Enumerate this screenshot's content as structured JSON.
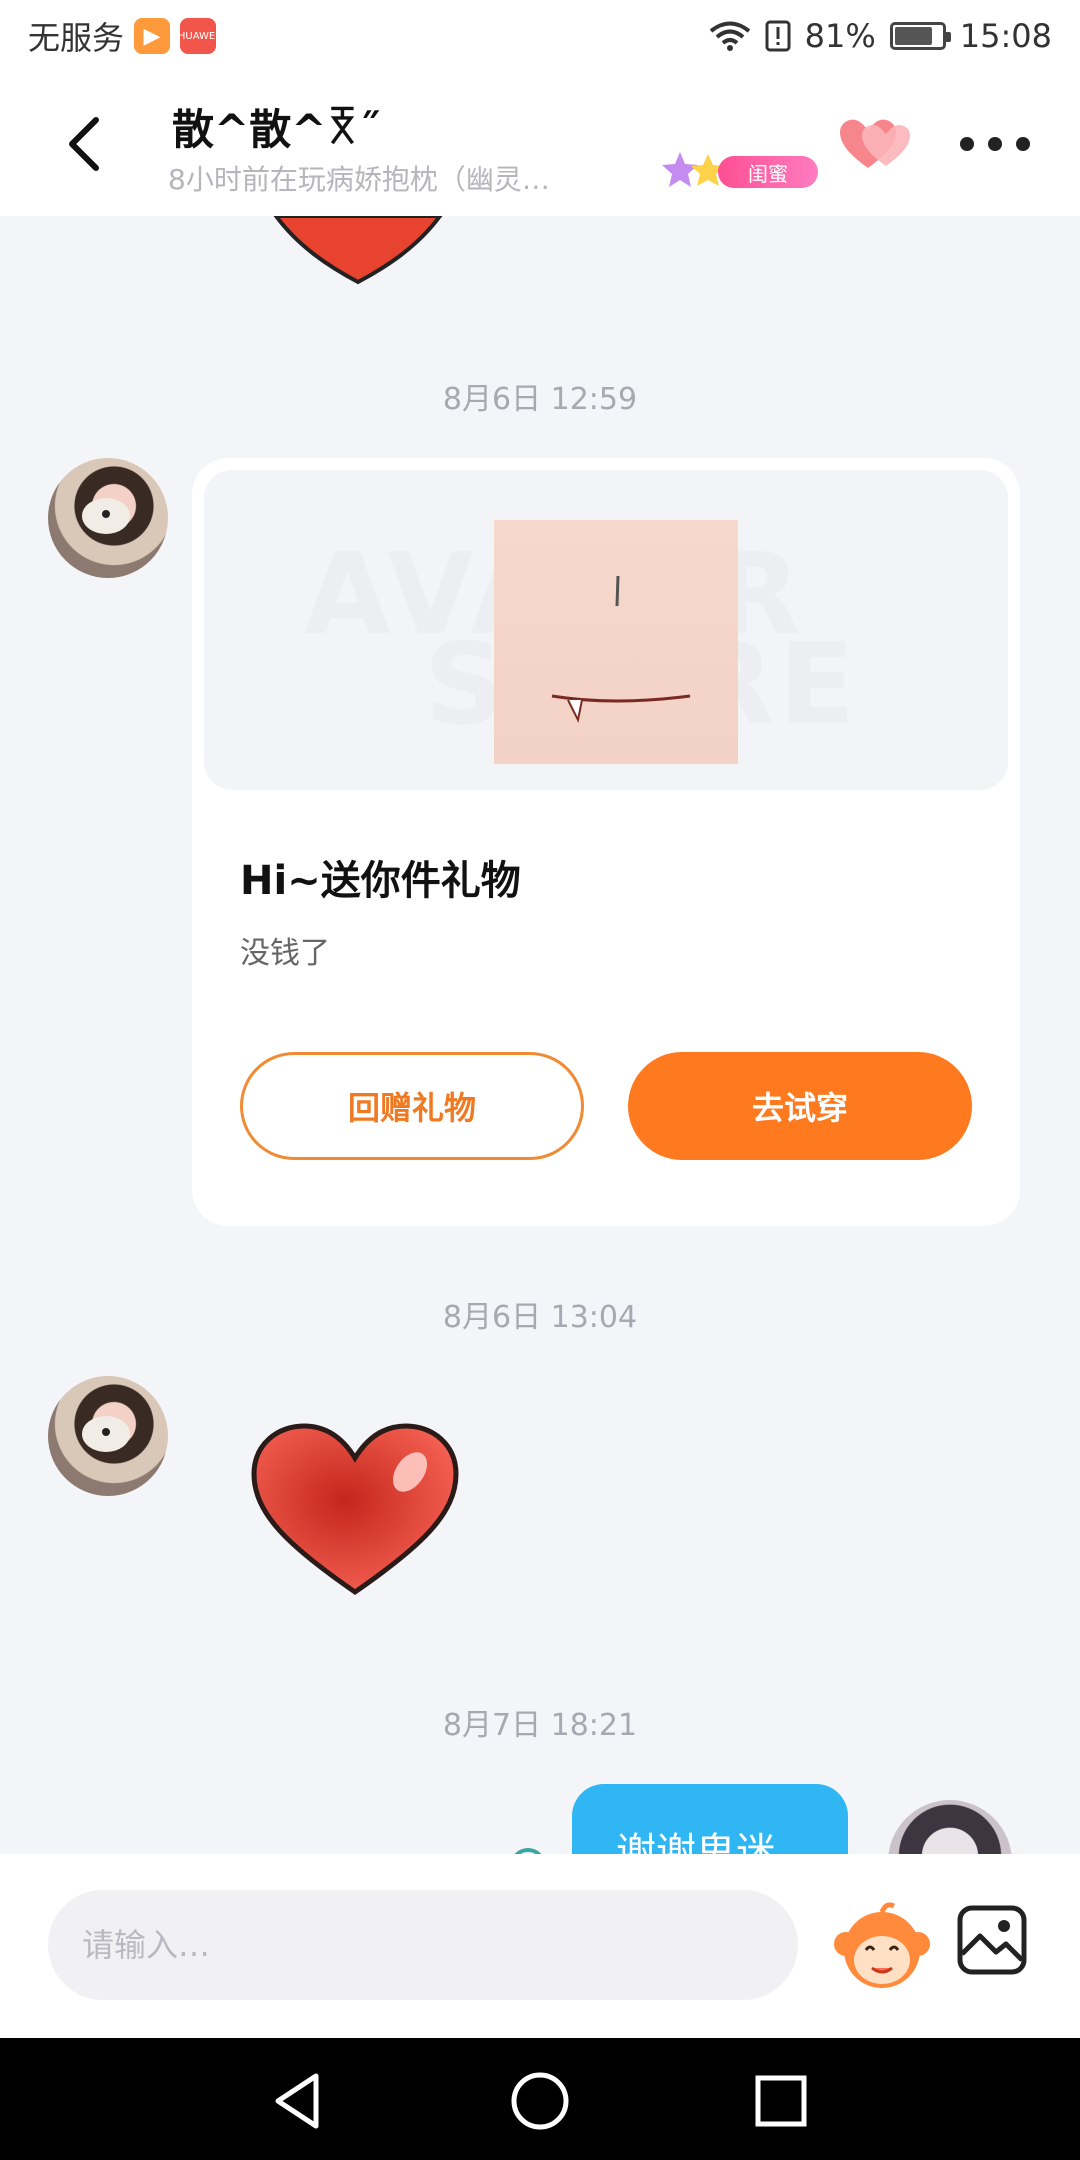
{
  "status_bar": {
    "carrier": "无服务",
    "app_badges": [
      "video-app-icon",
      "huawei-shop-icon"
    ],
    "shop_badge_label": "HUAWEI",
    "battery_percent": "81%",
    "battery_level": 0.81,
    "time": "15:08"
  },
  "header": {
    "title": "散^散^ꅃ˝",
    "subtitle": "8小时前在玩病娇抱枕（幽灵…",
    "relation_badge": "闺蜜",
    "colors": {
      "badge": "#ff4f92",
      "heart": "#f5737a"
    }
  },
  "chat": {
    "messages": [
      {
        "timestamp": "8月6日 12:59"
      },
      {
        "gift_card": {
          "watermark_line1": "AVATAR",
          "watermark_line2": "STORE",
          "title": "Hi~送你件礼物",
          "subtitle": "没钱了",
          "return_button": "回赠礼物",
          "try_button": "去试穿"
        }
      },
      {
        "timestamp": "8月6日 13:04"
      },
      {
        "timestamp": "8月7日 18:21"
      },
      {
        "outgoing_text": "谢谢鬼迷"
      }
    ],
    "colors": {
      "accent": "#ff7a1e",
      "bubble": "#2fb6f3",
      "background": "#f4f5f9"
    }
  },
  "input_bar": {
    "placeholder": "请输入…"
  },
  "nav_bar": {
    "buttons": [
      "back-icon",
      "home-icon",
      "recents-icon"
    ]
  }
}
